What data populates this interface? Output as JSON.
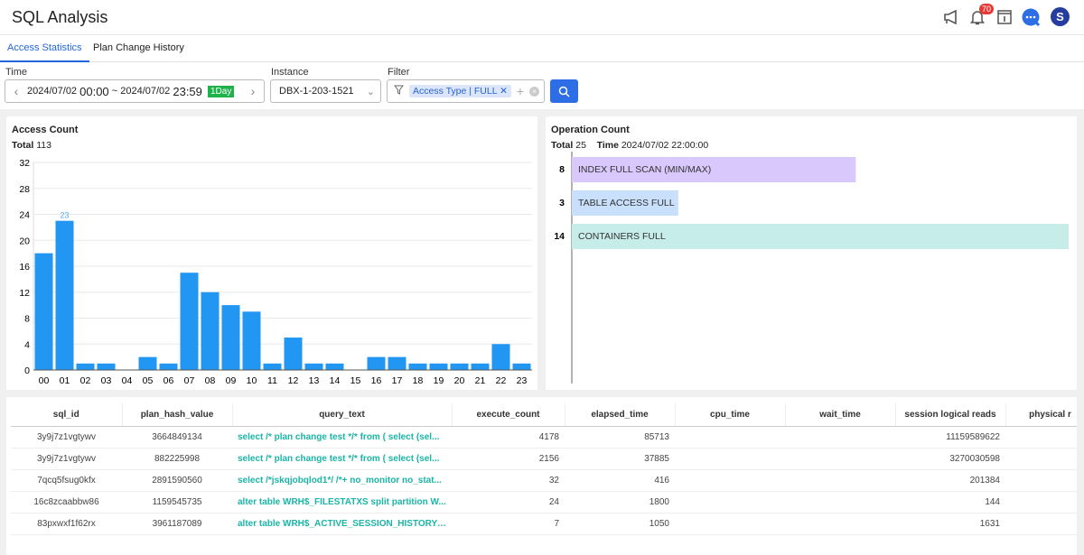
{
  "app": {
    "title": "SQL Analysis",
    "notification_count": "70",
    "avatar_letter": "S",
    "icons": [
      "megaphone-icon",
      "bell-icon",
      "info-panel-icon",
      "chat-icon",
      "avatar"
    ]
  },
  "tabs": [
    {
      "label": "Access Statistics",
      "active": true
    },
    {
      "label": "Plan Change History",
      "active": false
    }
  ],
  "filters": {
    "time_label": "Time",
    "start_date": "2024/07/02",
    "start_time": "00:00",
    "sep": "~",
    "end_date": "2024/07/02",
    "end_time": "23:59",
    "range_badge": "1Day",
    "instance_label": "Instance",
    "instance_value": "DBX-1-203-1521",
    "filter_label": "Filter",
    "filter_chip": "Access Type | FULL"
  },
  "colors": {
    "accent": "#2d6ee6",
    "bar": "#2196f3",
    "badge_green": "#1fb24a",
    "query_link": "#1bb5a8"
  },
  "access_count": {
    "title": "Access Count",
    "total_label": "Total",
    "total": "113"
  },
  "operation_count": {
    "title": "Operation Count",
    "total_label": "Total",
    "total": "25",
    "time_label": "Time",
    "time": "2024/07/02 22:00:00"
  },
  "chart_data": [
    {
      "type": "bar",
      "title": "Access Count",
      "categories": [
        "00",
        "01",
        "02",
        "03",
        "04",
        "05",
        "06",
        "07",
        "08",
        "09",
        "10",
        "11",
        "12",
        "13",
        "14",
        "15",
        "16",
        "17",
        "18",
        "19",
        "20",
        "21",
        "22",
        "23"
      ],
      "values": [
        18,
        23,
        1,
        1,
        0,
        2,
        1,
        15,
        12,
        10,
        9,
        1,
        5,
        1,
        1,
        0,
        2,
        2,
        1,
        1,
        1,
        1,
        4,
        1
      ],
      "ylim": [
        0,
        32
      ],
      "yticks": [
        0,
        4,
        8,
        12,
        16,
        20,
        24,
        28,
        32
      ],
      "grid": true,
      "labeled_value": {
        "category": "01",
        "label": "23"
      }
    },
    {
      "type": "bar",
      "orientation": "horizontal",
      "title": "Operation Count",
      "categories": [
        "INDEX FULL SCAN (MIN/MAX)",
        "TABLE ACCESS FULL",
        "CONTAINERS FULL"
      ],
      "values": [
        8,
        3,
        14
      ],
      "colors": [
        "#d9c8fb",
        "#c8e0fb",
        "#c6ede9"
      ]
    }
  ],
  "table": {
    "columns": [
      "sql_id",
      "plan_hash_value",
      "query_text",
      "execute_count",
      "elapsed_time",
      "cpu_time",
      "wait_time",
      "session logical reads",
      "physical r"
    ],
    "rows": [
      [
        "3y9j7z1vgtywv",
        "3664849134",
        "select /* plan change test */* from ( select (sel...",
        "4178",
        "85713",
        "",
        "",
        "11159589622",
        ""
      ],
      [
        "3y9j7z1vgtywv",
        "882225998",
        "select /* plan change test */* from ( select (sel...",
        "2156",
        "37885",
        "",
        "",
        "3270030598",
        ""
      ],
      [
        "7qcq5fsug0kfx",
        "2891590560",
        "select /*jskqjobqlod1*/ /*+ no_monitor no_stat...",
        "32",
        "416",
        "",
        "",
        "201384",
        ""
      ],
      [
        "16c8zcaabbw86",
        "1159545735",
        "alter table WRH$_FILESTATXS split partition W...",
        "24",
        "1800",
        "",
        "",
        "144",
        ""
      ],
      [
        "83pxwxf1f62rx",
        "3961187089",
        "alter table WRH$_ACTIVE_SESSION_HISTORY ...",
        "7",
        "1050",
        "",
        "",
        "1631",
        ""
      ]
    ]
  }
}
